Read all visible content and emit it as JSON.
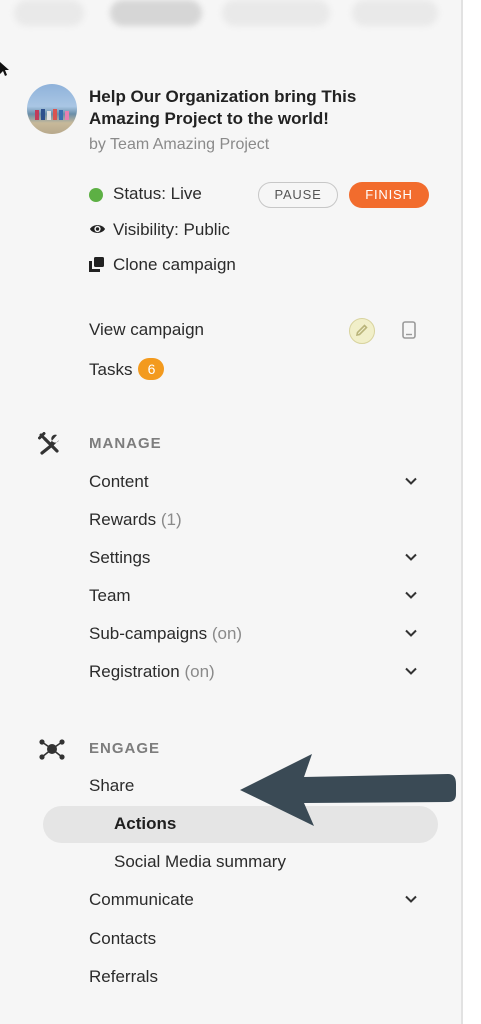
{
  "campaign": {
    "title": "Help Our Organization bring This Amazing Project to the world!",
    "byline": "by Team Amazing Project"
  },
  "status": {
    "status_text": "Status: Live",
    "status_color": "#5db044",
    "pause_label": "PAUSE",
    "finish_label": "FINISH",
    "finish_color": "#f26c2d",
    "visibility_text": "Visibility: Public",
    "clone_text": "Clone campaign"
  },
  "links": {
    "view_campaign": "View campaign",
    "tasks": "Tasks",
    "tasks_count": "6"
  },
  "manage": {
    "title": "MANAGE",
    "items": [
      {
        "label": "Content",
        "extra": "",
        "has_chevron": true
      },
      {
        "label": "Rewards",
        "extra": "(1)",
        "has_chevron": false
      },
      {
        "label": "Settings",
        "extra": "",
        "has_chevron": true
      },
      {
        "label": "Team",
        "extra": "",
        "has_chevron": true
      },
      {
        "label": "Sub-campaigns",
        "extra": "(on)",
        "has_chevron": true
      },
      {
        "label": "Registration",
        "extra": "(on)",
        "has_chevron": true
      }
    ]
  },
  "engage": {
    "title": "ENGAGE",
    "share": "Share",
    "share_children": [
      "Actions",
      "Social Media summary"
    ],
    "active_child": "Actions",
    "items": [
      {
        "label": "Communicate",
        "has_chevron": true
      },
      {
        "label": "Contacts",
        "has_chevron": false
      },
      {
        "label": "Referrals",
        "has_chevron": false
      }
    ]
  },
  "icons": {
    "status": "status-dot-icon",
    "visibility": "eye-icon",
    "clone": "clone-icon",
    "edit": "pencil-icon",
    "preview": "tablet-icon",
    "manage": "tools-icon",
    "engage": "network-icon",
    "expand": "chevron-down-icon",
    "annotation": "arrow-left-icon"
  }
}
